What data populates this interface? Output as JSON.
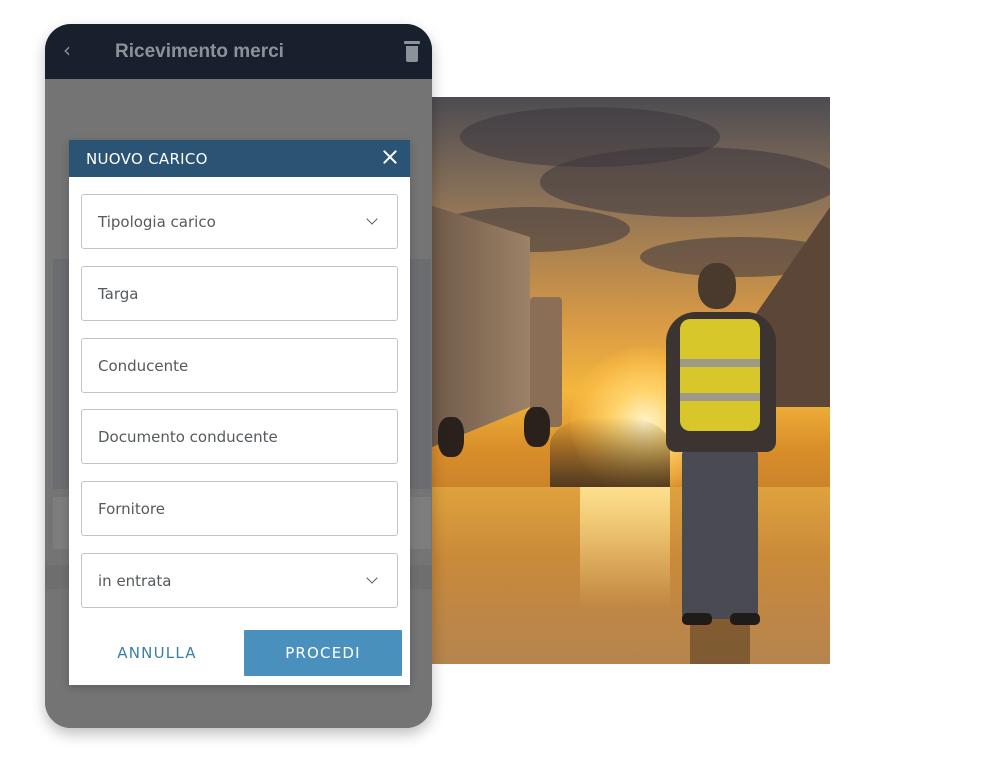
{
  "app": {
    "title": "Ricevimento merci",
    "back_icon": "chevron-left-icon",
    "trash_icon": "trash-icon"
  },
  "dialog": {
    "title": "NUOVO CARICO",
    "close_icon": "close-icon",
    "fields": [
      {
        "label": "Tipologia carico",
        "type": "select"
      },
      {
        "label": "Targa",
        "type": "text"
      },
      {
        "label": "Conducente",
        "type": "text"
      },
      {
        "label": "Documento conducente",
        "type": "text"
      },
      {
        "label": "Fornitore",
        "type": "text"
      },
      {
        "label": "in entrata",
        "type": "select"
      }
    ],
    "cancel_label": "ANNULLA",
    "proceed_label": "PROCEDI"
  },
  "colors": {
    "header_dark": "#17202c",
    "dialog_header": "#2b5474",
    "primary_button": "#4a90bd",
    "cancel_text": "#3c7fa6"
  },
  "photo": {
    "subject": "warehouse-worker-sunset-photo"
  }
}
